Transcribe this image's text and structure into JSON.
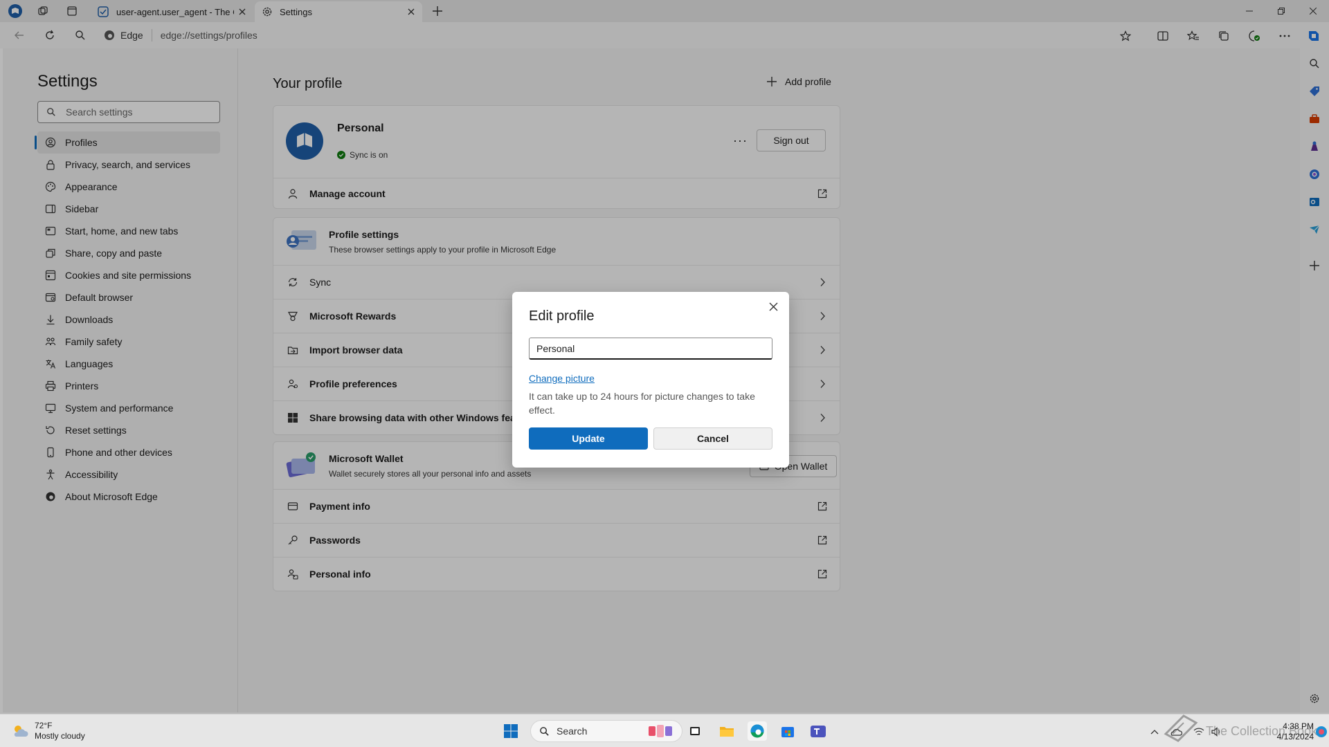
{
  "browser": {
    "tabs": [
      {
        "title": "user-agent.user_agent - The Coll",
        "active": false
      },
      {
        "title": "Settings",
        "active": true
      }
    ],
    "address": {
      "site": "Edge",
      "url": "edge://settings/profiles"
    }
  },
  "settings": {
    "title": "Settings",
    "search_placeholder": "Search settings",
    "nav": [
      {
        "label": "Profiles",
        "icon": "profile-icon",
        "selected": true
      },
      {
        "label": "Privacy, search, and services",
        "icon": "lock-icon"
      },
      {
        "label": "Appearance",
        "icon": "palette-icon"
      },
      {
        "label": "Sidebar",
        "icon": "sidebar-icon"
      },
      {
        "label": "Start, home, and new tabs",
        "icon": "home-icon"
      },
      {
        "label": "Share, copy and paste",
        "icon": "share-icon"
      },
      {
        "label": "Cookies and site permissions",
        "icon": "cookie-icon"
      },
      {
        "label": "Default browser",
        "icon": "browser-icon"
      },
      {
        "label": "Downloads",
        "icon": "download-icon"
      },
      {
        "label": "Family safety",
        "icon": "family-icon"
      },
      {
        "label": "Languages",
        "icon": "language-icon"
      },
      {
        "label": "Printers",
        "icon": "printer-icon"
      },
      {
        "label": "System and performance",
        "icon": "system-icon"
      },
      {
        "label": "Reset settings",
        "icon": "reset-icon"
      },
      {
        "label": "Phone and other devices",
        "icon": "phone-icon"
      },
      {
        "label": "Accessibility",
        "icon": "accessibility-icon"
      },
      {
        "label": "About Microsoft Edge",
        "icon": "edge-logo-icon"
      }
    ]
  },
  "profile": {
    "heading": "Your profile",
    "add_profile": "Add profile",
    "name": "Personal",
    "sync_status": "Sync is on",
    "more": "···",
    "sign_out": "Sign out",
    "manage_account": "Manage account",
    "profile_settings_title": "Profile settings",
    "profile_settings_sub": "These browser settings apply to your profile in Microsoft Edge",
    "rows": [
      {
        "label": "Sync",
        "icon": "sync-icon"
      },
      {
        "label": "Microsoft Rewards",
        "icon": "rewards-icon"
      },
      {
        "label": "Import browser data",
        "icon": "import-icon"
      },
      {
        "label": "Profile preferences",
        "icon": "preferences-icon"
      },
      {
        "label": "Share browsing data with other Windows features",
        "icon": "windows-icon"
      }
    ],
    "wallet_title": "Microsoft Wallet",
    "wallet_sub": "Wallet securely stores all your personal info and assets",
    "open_wallet": "Open Wallet",
    "wallet_rows": [
      {
        "label": "Payment info",
        "icon": "card-icon"
      },
      {
        "label": "Passwords",
        "icon": "key-icon"
      },
      {
        "label": "Personal info",
        "icon": "person-info-icon"
      }
    ]
  },
  "dialog": {
    "title": "Edit profile",
    "name_value": "Personal",
    "change_picture": "Change picture",
    "note": "It can take up to 24 hours for picture changes to take effect.",
    "update": "Update",
    "cancel": "Cancel"
  },
  "taskbar": {
    "temperature": "72°F",
    "weather": "Mostly cloudy",
    "search": "Search",
    "time": "4:38 PM",
    "date": "4/13/2024",
    "watermark": "The Collection Book"
  },
  "colors": {
    "accent": "#0f6cbd",
    "sync_green": "#107c10"
  }
}
